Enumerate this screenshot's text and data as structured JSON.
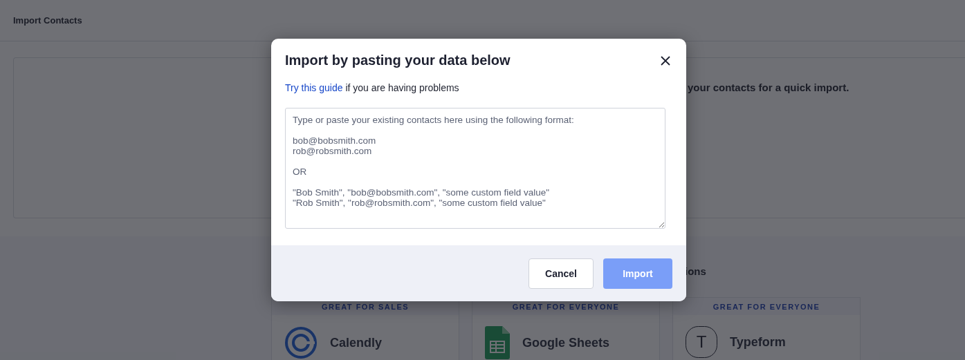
{
  "page": {
    "title": "Import Contacts",
    "card_text": "your contacts for a quick import.",
    "section_heading": "ions",
    "integrations": [
      {
        "tag": "GREAT FOR SALES",
        "name": "Calendly",
        "kind": "calendly"
      },
      {
        "tag": "GREAT FOR EVERYONE",
        "name": "Google Sheets",
        "kind": "sheets"
      },
      {
        "tag": "GREAT FOR EVERYONE",
        "name": "Typeform",
        "kind": "typeform",
        "letter": "T"
      }
    ]
  },
  "dialog": {
    "title": "Import by pasting your data below",
    "link": "Try this guide",
    "hint": " if you are having problems",
    "placeholder": "Type or paste your existing contacts here using the following format:\n\nbob@bobsmith.com\nrob@robsmith.com\n\nOR\n\n\"Bob Smith\", \"bob@bobsmith.com\", \"some custom field value\"\n\"Rob Smith\", \"rob@robsmith.com\", \"some custom field value\"",
    "buttons": [
      {
        "label": "Cancel",
        "kind": "secondary"
      },
      {
        "label": "Import",
        "kind": "primary",
        "disabled": true
      }
    ]
  }
}
